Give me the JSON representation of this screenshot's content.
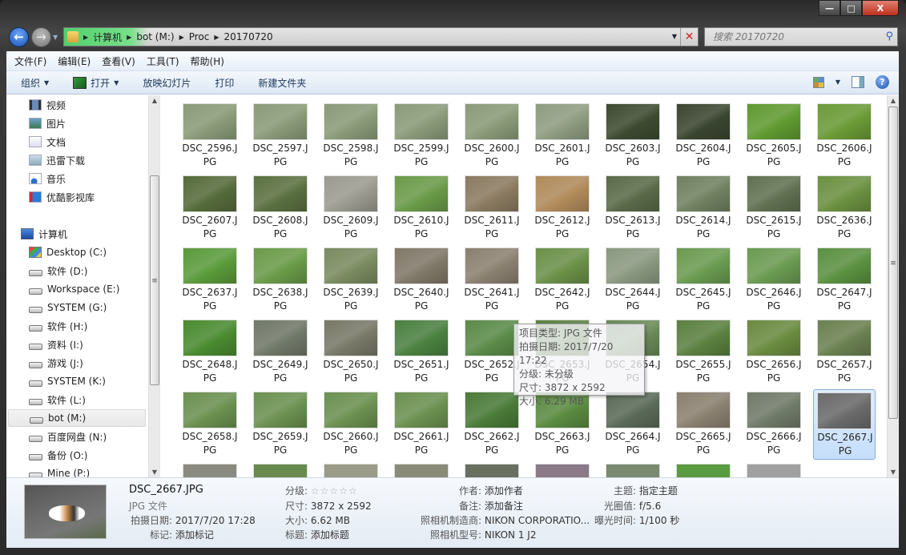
{
  "window": {
    "min": "—",
    "max": "□",
    "close": "X"
  },
  "address": {
    "crumbs": [
      "计算机",
      "bot (M:)",
      "Proc",
      "20170720"
    ]
  },
  "search": {
    "placeholder": "搜索 20170720"
  },
  "menu": [
    "文件(F)",
    "编辑(E)",
    "查看(V)",
    "工具(T)",
    "帮助(H)"
  ],
  "toolbar": {
    "organize": "组织",
    "open": "打开",
    "slideshow": "放映幻灯片",
    "print": "打印",
    "new_folder": "新建文件夹"
  },
  "nav": {
    "favorites": [
      {
        "label": "视频",
        "icon": "video-icon"
      },
      {
        "label": "图片",
        "icon": "pictures-icon"
      },
      {
        "label": "文档",
        "icon": "documents-icon"
      },
      {
        "label": "迅雷下载",
        "icon": "download-icon"
      },
      {
        "label": "音乐",
        "icon": "music-icon"
      },
      {
        "label": "优酷影视库",
        "icon": "youku-icon"
      }
    ],
    "computer": "计算机",
    "drives": [
      "Desktop (C:)",
      "软件 (D:)",
      "Workspace (E:)",
      "SYSTEM (G:)",
      "软件 (H:)",
      "资料 (I:)",
      "游戏 (J:)",
      "SYSTEM (K:)",
      "软件 (L:)",
      "bot (M:)",
      "百度网盘 (N:)",
      "备份 (O:)",
      "Mine (P:)"
    ],
    "selected_drive": "bot (M:)"
  },
  "files": [
    {
      "name": "DSC_2596.JPG",
      "color": "#8a9a78"
    },
    {
      "name": "DSC_2597.JPG",
      "color": "#8a9a78"
    },
    {
      "name": "DSC_2598.JPG",
      "color": "#8a9a78"
    },
    {
      "name": "DSC_2599.JPG",
      "color": "#8a9a78"
    },
    {
      "name": "DSC_2600.JPG",
      "color": "#8a9a78"
    },
    {
      "name": "DSC_2601.JPG",
      "color": "#8e9c80"
    },
    {
      "name": "DSC_2603.JPG",
      "color": "#3d4a30"
    },
    {
      "name": "DSC_2604.JPG",
      "color": "#3a4530"
    },
    {
      "name": "DSC_2605.JPG",
      "color": "#5f9a30"
    },
    {
      "name": "DSC_2606.JPG",
      "color": "#6a9a35"
    },
    {
      "name": "DSC_2607.JPG",
      "color": "#556b3a"
    },
    {
      "name": "DSC_2608.JPG",
      "color": "#5a7040"
    },
    {
      "name": "DSC_2609.JPG",
      "color": "#9a9a90"
    },
    {
      "name": "DSC_2610.JPG",
      "color": "#6a9a48"
    },
    {
      "name": "DSC_2611.JPG",
      "color": "#8a7a60"
    },
    {
      "name": "DSC_2612.JPG",
      "color": "#b08a5a"
    },
    {
      "name": "DSC_2613.JPG",
      "color": "#5a6a48"
    },
    {
      "name": "DSC_2614.JPG",
      "color": "#708060"
    },
    {
      "name": "DSC_2615.JPG",
      "color": "#607050"
    },
    {
      "name": "DSC_2636.JPG",
      "color": "#6a9040"
    },
    {
      "name": "DSC_2637.JPG",
      "color": "#5a9a3a"
    },
    {
      "name": "DSC_2638.JPG",
      "color": "#6a9a48"
    },
    {
      "name": "DSC_2639.JPG",
      "color": "#7a8a60"
    },
    {
      "name": "DSC_2640.JPG",
      "color": "#807868"
    },
    {
      "name": "DSC_2641.JPG",
      "color": "#8a8070"
    },
    {
      "name": "DSC_2642.JPG",
      "color": "#6a9048"
    },
    {
      "name": "DSC_2644.JPG",
      "color": "#8a9880"
    },
    {
      "name": "DSC_2645.JPG",
      "color": "#6a9a50"
    },
    {
      "name": "DSC_2646.JPG",
      "color": "#6a9a50"
    },
    {
      "name": "DSC_2647.JPG",
      "color": "#5a9040"
    },
    {
      "name": "DSC_2648.JPG",
      "color": "#4a8a30"
    },
    {
      "name": "DSC_2649.JPG",
      "color": "#707868"
    },
    {
      "name": "DSC_2650.JPG",
      "color": "#787868"
    },
    {
      "name": "DSC_2651.JPG",
      "color": "#4a8040"
    },
    {
      "name": "DSC_2652.JPG",
      "color": "#5a8a48"
    },
    {
      "name": "DSC_2653.JPG",
      "color": "#5a8040"
    },
    {
      "name": "DSC_2654.JPG",
      "color": "#6a8a58"
    },
    {
      "name": "DSC_2655.JPG",
      "color": "#5a8040"
    },
    {
      "name": "DSC_2656.JPG",
      "color": "#6a8a40"
    },
    {
      "name": "DSC_2657.JPG",
      "color": "#6a8050"
    },
    {
      "name": "DSC_2658.JPG",
      "color": "#6a9050"
    },
    {
      "name": "DSC_2659.JPG",
      "color": "#6a9050"
    },
    {
      "name": "DSC_2660.JPG",
      "color": "#6a9050"
    },
    {
      "name": "DSC_2661.JPG",
      "color": "#6a9050"
    },
    {
      "name": "DSC_2662.JPG",
      "color": "#4a7a38"
    },
    {
      "name": "DSC_2663.JPG",
      "color": "#5a8a40"
    },
    {
      "name": "DSC_2664.JPG",
      "color": "#5a6a58"
    },
    {
      "name": "DSC_2665.JPG",
      "color": "#8a8070"
    },
    {
      "name": "DSC_2666.JPG",
      "color": "#707a68"
    },
    {
      "name": "DSC_2667.JPG",
      "color": "#6a6a6a",
      "selected": true
    }
  ],
  "partial_row_colors": [
    "#8a8a80",
    "#6a8a50",
    "#9a9a88",
    "#8a8a78",
    "#6a7060",
    "#8a7a88",
    "#7a8a70",
    "#5a9a40",
    "#a0a0a0"
  ],
  "tooltip": [
    "项目类型: JPG 文件",
    "拍摄日期: 2017/7/20 17:22",
    "分级: 未分级",
    "尺寸: 3872 x 2592",
    "大小: 6.29 MB"
  ],
  "details": {
    "filename": "DSC_2667.JPG",
    "type": "JPG 文件",
    "date_k": "拍摄日期:",
    "date_v": "2017/7/20 17:28",
    "tags_k": "标记:",
    "tags_v": "添加标记",
    "rating_k": "分级:",
    "rating_stars": "☆☆☆☆☆",
    "size_k": "尺寸:",
    "size_v": "3872 x 2592",
    "filesize_k": "大小:",
    "filesize_v": "6.62 MB",
    "title_k": "标题:",
    "title_v": "添加标题",
    "author_k": "作者:",
    "author_v": "添加作者",
    "comment_k": "备注:",
    "comment_v": "添加备注",
    "maker_k": "照相机制造商:",
    "maker_v": "NIKON CORPORATIO...",
    "model_k": "照相机型号:",
    "model_v": "NIKON 1 J2",
    "subject_k": "主题:",
    "subject_v": "指定主题",
    "aperture_k": "光圈值:",
    "aperture_v": "f/5.6",
    "exposure_k": "曝光时间:",
    "exposure_v": "1/100 秒"
  }
}
